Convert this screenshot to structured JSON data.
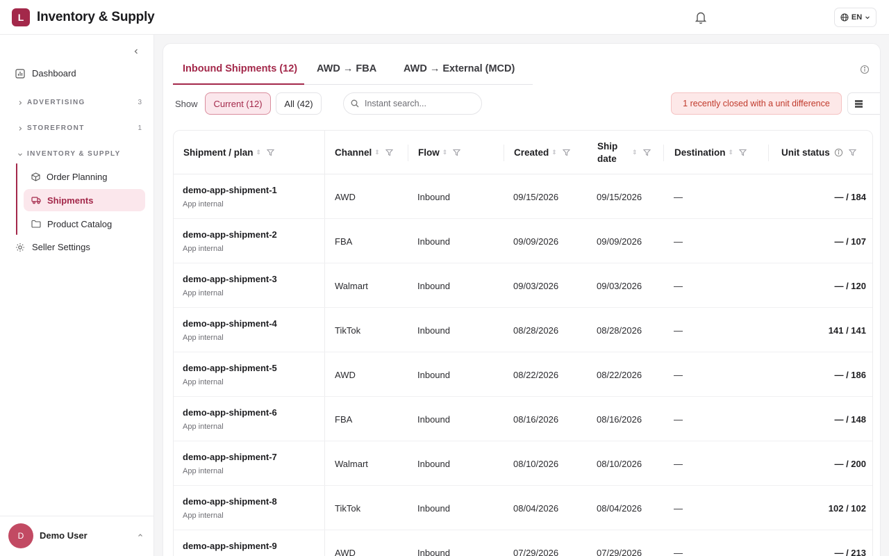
{
  "app": {
    "logo_letter": "L",
    "title": "Inventory & Supply",
    "language": "EN"
  },
  "sidebar": {
    "dashboard": "Dashboard",
    "sections": [
      {
        "label": "ADVERTISING",
        "count": "3"
      },
      {
        "label": "STOREFRONT",
        "count": "1"
      },
      {
        "label": "INVENTORY & SUPPLY",
        "count": ""
      }
    ],
    "sub_items": [
      "Order Planning",
      "Shipments",
      "Product Catalog"
    ],
    "seller_settings": "Seller Settings",
    "user": {
      "initial": "D",
      "name": "Demo User"
    }
  },
  "tabs": [
    "Inbound Shipments (12)",
    "AWD → FBA",
    "AWD → External (MCD)"
  ],
  "filters": {
    "show_label": "Show",
    "current": "Current (12)",
    "all": "All (42)",
    "search_placeholder": "Instant search...",
    "alert": "1 recently closed with a unit difference"
  },
  "table": {
    "headers": [
      "Shipment / plan",
      "Channel",
      "Flow",
      "Created",
      "Ship date",
      "Destination",
      "Unit status"
    ],
    "rows": [
      {
        "name": "demo-app-shipment-1",
        "sub": "App internal",
        "channel": "AWD",
        "flow": "Inbound",
        "created": "09/15/2026",
        "ship": "09/15/2026",
        "dest": "—",
        "units": "— / 184"
      },
      {
        "name": "demo-app-shipment-2",
        "sub": "App internal",
        "channel": "FBA",
        "flow": "Inbound",
        "created": "09/09/2026",
        "ship": "09/09/2026",
        "dest": "—",
        "units": "— / 107"
      },
      {
        "name": "demo-app-shipment-3",
        "sub": "App internal",
        "channel": "Walmart",
        "flow": "Inbound",
        "created": "09/03/2026",
        "ship": "09/03/2026",
        "dest": "—",
        "units": "— / 120"
      },
      {
        "name": "demo-app-shipment-4",
        "sub": "App internal",
        "channel": "TikTok",
        "flow": "Inbound",
        "created": "08/28/2026",
        "ship": "08/28/2026",
        "dest": "—",
        "units": "141 / 141"
      },
      {
        "name": "demo-app-shipment-5",
        "sub": "App internal",
        "channel": "AWD",
        "flow": "Inbound",
        "created": "08/22/2026",
        "ship": "08/22/2026",
        "dest": "—",
        "units": "— / 186"
      },
      {
        "name": "demo-app-shipment-6",
        "sub": "App internal",
        "channel": "FBA",
        "flow": "Inbound",
        "created": "08/16/2026",
        "ship": "08/16/2026",
        "dest": "—",
        "units": "— / 148"
      },
      {
        "name": "demo-app-shipment-7",
        "sub": "App internal",
        "channel": "Walmart",
        "flow": "Inbound",
        "created": "08/10/2026",
        "ship": "08/10/2026",
        "dest": "—",
        "units": "— / 200"
      },
      {
        "name": "demo-app-shipment-8",
        "sub": "App internal",
        "channel": "TikTok",
        "flow": "Inbound",
        "created": "08/04/2026",
        "ship": "08/04/2026",
        "dest": "—",
        "units": "102 / 102"
      },
      {
        "name": "demo-app-shipment-9",
        "sub": "",
        "channel": "AWD",
        "flow": "Inbound",
        "created": "07/29/2026",
        "ship": "07/29/2026",
        "dest": "—",
        "units": "— / 213"
      }
    ]
  },
  "colors": {
    "accent": "#a3284a",
    "accent_bg": "#fbe7ec",
    "alert_bg": "#fde8e8",
    "alert_text": "#c0392b"
  }
}
